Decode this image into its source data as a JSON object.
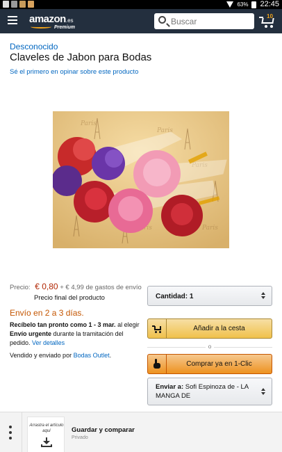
{
  "status_bar": {
    "battery": "63%",
    "time": "22:45"
  },
  "header": {
    "logo_text": "amazon",
    "logo_tld": ".es",
    "logo_sub": "Premium",
    "search_placeholder": "Buscar",
    "cart_count": "10"
  },
  "product": {
    "brand": "Desconocido",
    "title": "Claveles de Jabon para Bodas",
    "first_review_link": "Sé el primero en opinar sobre este producto",
    "price_label": "Precio:",
    "price": "€ 0,80",
    "shipping": "+ € 4,99 de gastos de envío",
    "final_price_note": "Precio final del producto",
    "delivery": "Envío en 2 a 3 días.",
    "receive_prefix": "Recíbelo tan pronto como",
    "receive_dates": "1 - 3 mar.",
    "receive_mid": "al elegir",
    "receive_option": "Envío urgente",
    "receive_suffix": "durante la tramitación del pedido.",
    "details_link": "Ver detalles",
    "sold_by_prefix": "Vendido y enviado por",
    "seller": "Bodas Outlet",
    "sold_by_suffix": "."
  },
  "buy_box": {
    "quantity_label": "Cantidad:",
    "quantity_value": "1",
    "add_to_cart": "Añadir a la cesta",
    "or_text": "o",
    "buy_now": "Comprar ya en 1-Clic",
    "ship_to_label": "Enviar a:",
    "ship_to_value": "Sofi Espinoza de - LA MANGA DE"
  },
  "bottom_bar": {
    "drag_hint": "Arrastra el artículo aquí",
    "save_title": "Guardar y comparar",
    "save_sub": "Privado"
  },
  "colors": {
    "header_bg": "#232f3e",
    "link": "#0066c0",
    "price": "#b12704",
    "delivery": "#c45500",
    "cart_button": "#f0c14b",
    "buy_button": "#ed9220"
  }
}
